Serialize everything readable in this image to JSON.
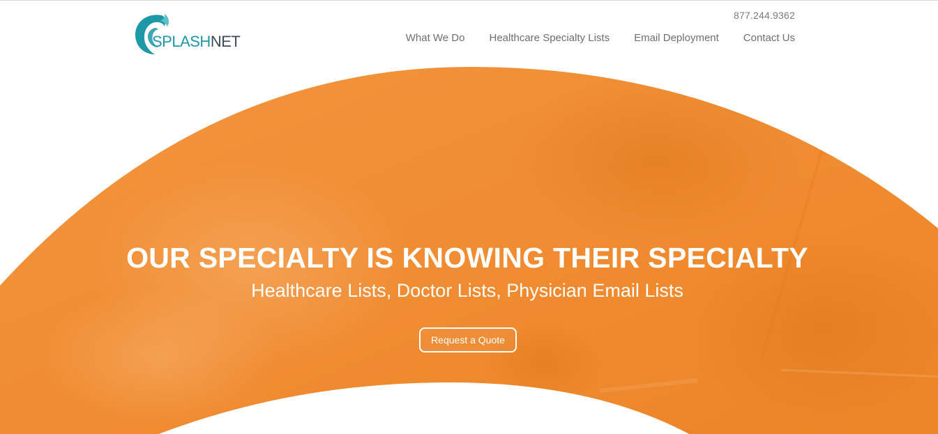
{
  "brand": {
    "name_part1": "SPLASH",
    "name_part2": "NET",
    "logo_icon": "wave-swirl-icon",
    "primary_color": "#1d98a6",
    "secondary_color": "#3b4c59"
  },
  "header": {
    "phone": "877.244.9362",
    "nav": [
      {
        "label": "What We Do"
      },
      {
        "label": "Healthcare Specialty Lists"
      },
      {
        "label": "Email Deployment"
      },
      {
        "label": "Contact Us"
      }
    ]
  },
  "hero": {
    "headline": "OUR SPECIALTY IS KNOWING THEIR SPECIALTY",
    "subheadline": "Healthcare Lists, Doctor Lists, Physician Email Lists",
    "cta_label": "Request a Quote",
    "accent_color": "#f08a2c"
  }
}
